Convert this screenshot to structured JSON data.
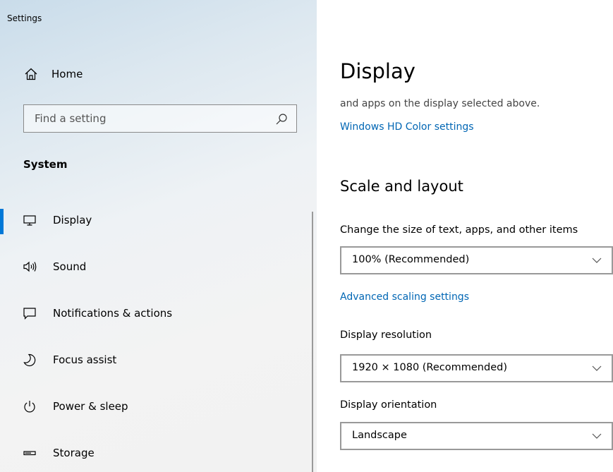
{
  "app": {
    "title": "Settings"
  },
  "sidebar": {
    "home_label": "Home",
    "search": {
      "placeholder": "Find a setting",
      "value": ""
    },
    "section_label": "System",
    "items": [
      {
        "label": "Display",
        "icon": "monitor-icon",
        "selected": true
      },
      {
        "label": "Sound",
        "icon": "speaker-icon",
        "selected": false
      },
      {
        "label": "Notifications & actions",
        "icon": "notification-icon",
        "selected": false
      },
      {
        "label": "Focus assist",
        "icon": "moon-icon",
        "selected": false
      },
      {
        "label": "Power & sleep",
        "icon": "power-icon",
        "selected": false
      },
      {
        "label": "Storage",
        "icon": "storage-icon",
        "selected": false
      }
    ]
  },
  "main": {
    "title": "Display",
    "description_fragment": "and apps on the display selected above.",
    "hd_color_link": "Windows HD Color settings",
    "scale_section": {
      "title": "Scale and layout",
      "scale_label": "Change the size of text, apps, and other items",
      "scale_value": "100% (Recommended)",
      "advanced_link": "Advanced scaling settings",
      "resolution_label": "Display resolution",
      "resolution_value": "1920 × 1080 (Recommended)",
      "orientation_label": "Display orientation",
      "orientation_value": "Landscape"
    }
  },
  "colors": {
    "accent": "#0078d7",
    "link": "#0066b4",
    "border": "#999999"
  }
}
